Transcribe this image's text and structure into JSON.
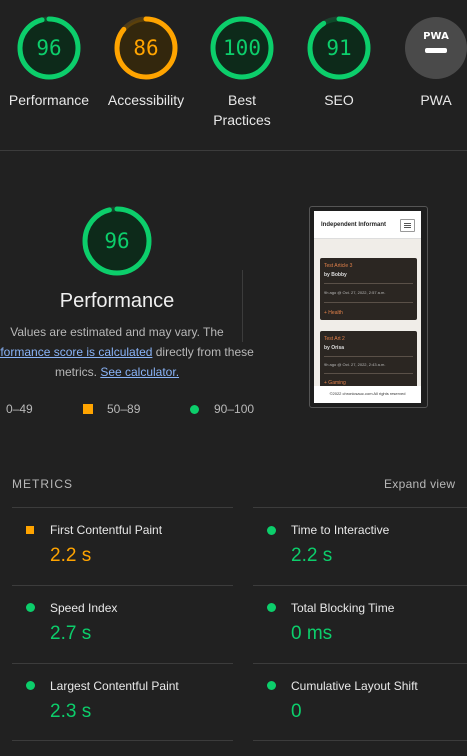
{
  "gauges": [
    {
      "score": "96",
      "label": "Performance",
      "color": "#0cce6b",
      "fill": "#0d2a1a",
      "fraction": 0.96
    },
    {
      "score": "86",
      "label": "Accessibility",
      "color": "#ffa400",
      "fill": "#33270d",
      "fraction": 0.86
    },
    {
      "score": "100",
      "label": "Best Practices",
      "color": "#0cce6b",
      "fill": "#0d2a1a",
      "fraction": 1.0
    },
    {
      "score": "91",
      "label": "SEO",
      "color": "#0cce6b",
      "fill": "#0d2a1a",
      "fraction": 0.91
    },
    {
      "badge": "PWA",
      "label": "PWA",
      "color": "#4a4a4a"
    }
  ],
  "performance": {
    "score": "96",
    "title": "Performance",
    "desc_line1": "Values are estimated and may vary. The",
    "desc_link": "performance score is calculated",
    "desc_after_link": " directly from these",
    "desc_line3": "metrics. ",
    "calc_link": "See calculator."
  },
  "legend": {
    "poor": "0–49",
    "average": "50–89",
    "good": "90–100"
  },
  "thumbnail": {
    "site_title": "Independent Informant",
    "menu_icon": "hamburger-icon",
    "articles": [
      {
        "title": "Test Article 3",
        "author": "by Bobby",
        "date": "9h ago @ Oct. 27, 2022, 2:57 a.m.",
        "tag": "+ Health"
      },
      {
        "title": "Test Art 2",
        "author": "by Orisa",
        "date": "9h ago @ Oct. 27, 2022, 2:43 a.m.",
        "tag": "+ Gaming"
      }
    ],
    "footer": "©2022 chronicsauc.com  All rights reserved"
  },
  "metrics": {
    "heading": "METRICS",
    "expand": "Expand view",
    "items": [
      {
        "name": "First Contentful Paint",
        "value": "2.2 s",
        "rating": "average"
      },
      {
        "name": "Time to Interactive",
        "value": "2.2 s",
        "rating": "good"
      },
      {
        "name": "Speed Index",
        "value": "2.7 s",
        "rating": "good"
      },
      {
        "name": "Total Blocking Time",
        "value": "0 ms",
        "rating": "good"
      },
      {
        "name": "Largest Contentful Paint",
        "value": "2.3 s",
        "rating": "good"
      },
      {
        "name": "Cumulative Layout Shift",
        "value": "0",
        "rating": "good"
      }
    ]
  }
}
